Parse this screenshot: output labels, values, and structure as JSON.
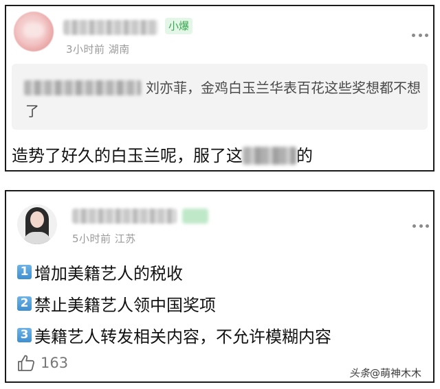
{
  "posts": [
    {
      "badge": "小爆",
      "meta": "3小时前 湖南",
      "quote_text": "刘亦菲，金鸡白玉兰华表百花这些奖想都不想了",
      "body_prefix": "造势了好久的白玉兰呢，服了这",
      "body_suffix": "的"
    },
    {
      "meta": "5小时前 江苏",
      "items": [
        {
          "num": "1",
          "text": "增加美籍艺人的税收"
        },
        {
          "num": "2",
          "text": "禁止美籍艺人领中国奖项"
        },
        {
          "num": "3",
          "text": "美籍艺人转发相关内容，不允许模糊内容"
        }
      ],
      "like_count": "163"
    }
  ],
  "watermark": {
    "prefix": "头条",
    "handle": "@萌神木木"
  },
  "colors": {
    "badge_text": "#35a94c",
    "badge_bg": "#e4f6e7",
    "meta_text": "#9a9a9a",
    "quote_bg": "#f3f3f3",
    "num_badge": "#4a98d6"
  }
}
